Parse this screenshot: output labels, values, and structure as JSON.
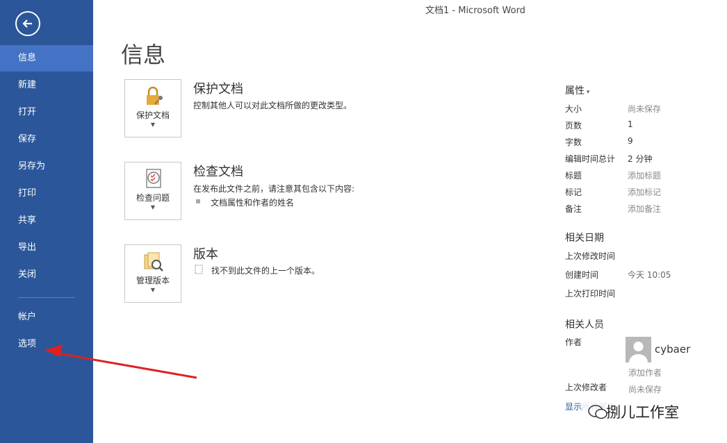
{
  "window": {
    "title": "文档1 - Microsoft Word"
  },
  "sidebar": {
    "items": [
      {
        "label": "信息",
        "active": true
      },
      {
        "label": "新建"
      },
      {
        "label": "打开"
      },
      {
        "label": "保存"
      },
      {
        "label": "另存为"
      },
      {
        "label": "打印"
      },
      {
        "label": "共享"
      },
      {
        "label": "导出"
      },
      {
        "label": "关闭"
      },
      {
        "label": "帐户"
      },
      {
        "label": "选项"
      }
    ],
    "back_icon": "back-arrow-icon"
  },
  "main": {
    "title": "信息",
    "sections": [
      {
        "button_label": "保护文档",
        "heading": "保护文档",
        "desc": "控制其他人可以对此文档所做的更改类型。",
        "icon": "lock-icon"
      },
      {
        "button_label": "检查问题",
        "heading": "检查文档",
        "desc": "在发布此文件之前，请注意其包含以下内容:",
        "bullet": "文档属性和作者的姓名",
        "icon": "inspect-icon"
      },
      {
        "button_label": "管理版本",
        "heading": "版本",
        "desc": "找不到此文件的上一个版本。",
        "icon": "versions-icon"
      }
    ]
  },
  "properties": {
    "heading": "属性",
    "rows": [
      {
        "key": "大小",
        "value": "尚未保存"
      },
      {
        "key": "页数",
        "value": "1"
      },
      {
        "key": "字数",
        "value": "9"
      },
      {
        "key": "编辑时间总计",
        "value": "2 分钟"
      },
      {
        "key": "标题",
        "value": "添加标题"
      },
      {
        "key": "标记",
        "value": "添加标记"
      },
      {
        "key": "备注",
        "value": "添加备注"
      }
    ],
    "dates_heading": "相关日期",
    "dates": [
      {
        "key": "上次修改时间",
        "value": ""
      },
      {
        "key": "创建时间",
        "value": "今天 10:05"
      },
      {
        "key": "上次打印时间",
        "value": ""
      }
    ],
    "people_heading": "相关人员",
    "author_key": "作者",
    "author_name": "cybaer",
    "add_author": "添加作者",
    "last_modified_by_key": "上次修改者",
    "last_modified_by_value": "尚未保存",
    "show_all_link": "显示所有属性"
  },
  "watermark": {
    "text": "捌儿工作室"
  },
  "colors": {
    "sidebar": "#2b579a",
    "sidebar_active": "#4472c4",
    "arrow": "#e02020"
  }
}
